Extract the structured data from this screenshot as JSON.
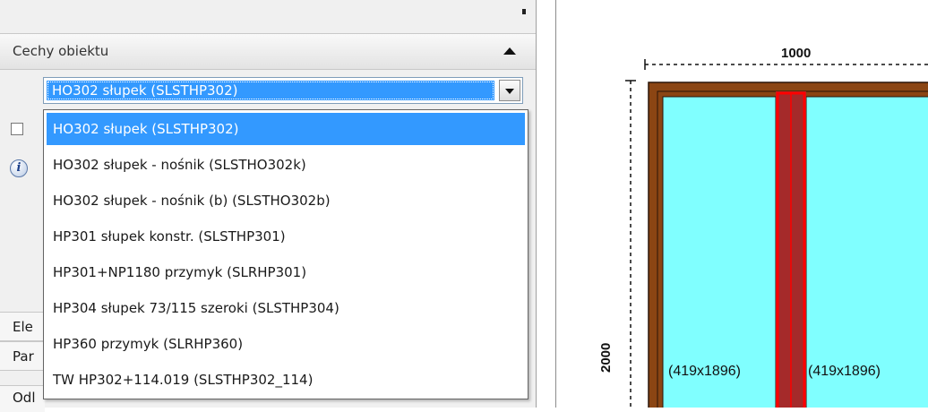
{
  "section": {
    "title": "Cechy obiektu"
  },
  "combo": {
    "selected": "HO302 słupek (SLSTHP302)"
  },
  "dropdown": {
    "items": [
      "HO302 słupek (SLSTHP302)",
      "HO302 słupek - nośnik (SLSTHO302k)",
      "HO302 słupek - nośnik (b) (SLSTHO302b)",
      "HP301 słupek konstr. (SLSTHP301)",
      "HP301+NP1180 przymyk (SLRHP301)",
      "HP304 słupek 73/115 szeroki (SLSTHP304)",
      "HP360 przymyk (SLRHP360)",
      "TW HP302+114.019 (SLSTHP302_114)"
    ],
    "selected_index": 0
  },
  "side_tabs": {
    "ele": "Ele",
    "par": "Par",
    "odl": "Odl"
  },
  "icons": {
    "info": "info-icon",
    "combo_arrow": "chevron-down-icon",
    "collapse": "chevron-up-icon"
  },
  "drawing": {
    "width_dim": "1000",
    "height_dim": "2000",
    "left_pane": "(419x1896)",
    "right_pane": "(419x1896)"
  },
  "colors": {
    "selection": "#3399ff",
    "frame": "#8b4513",
    "glass": "#80ffff",
    "mullion": "#ff0000"
  }
}
